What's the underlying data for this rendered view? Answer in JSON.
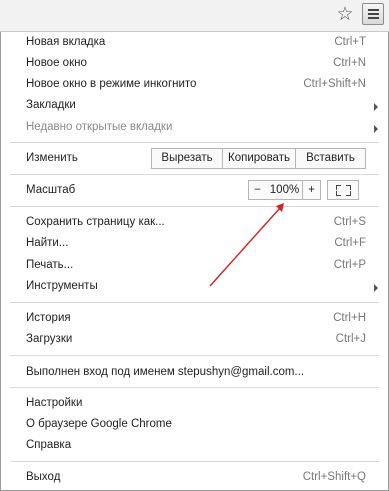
{
  "toolbar": {
    "star_glyph": "☆"
  },
  "menu": {
    "items": [
      {
        "label": "Новая вкладка",
        "shortcut": "Ctrl+T"
      },
      {
        "label": "Новое окно",
        "shortcut": "Ctrl+N"
      },
      {
        "label": "Новое окно в режиме инкогнито",
        "shortcut": "Ctrl+Shift+N"
      },
      {
        "label": "Закладки",
        "shortcut": ""
      },
      {
        "label": "Недавно открытые вкладки",
        "shortcut": ""
      }
    ],
    "edit": {
      "label": "Изменить",
      "cut": "Вырезать",
      "copy": "Копировать",
      "paste": "Вставить"
    },
    "zoom": {
      "label": "Масштаб",
      "minus": "−",
      "value": "100%",
      "plus": "+"
    },
    "page_items": [
      {
        "label": "Сохранить страницу как...",
        "shortcut": "Ctrl+S"
      },
      {
        "label": "Найти...",
        "shortcut": "Ctrl+F"
      },
      {
        "label": "Печать...",
        "shortcut": "Ctrl+P"
      },
      {
        "label": "Инструменты",
        "shortcut": ""
      }
    ],
    "history_items": [
      {
        "label": "История",
        "shortcut": "Ctrl+H"
      },
      {
        "label": "Загрузки",
        "shortcut": "Ctrl+J"
      }
    ],
    "signed_in": "Выполнен вход под именем stepushyn@gmail.com...",
    "settings_items": [
      {
        "label": "Настройки"
      },
      {
        "label": "О браузере Google Chrome"
      },
      {
        "label": "Справка"
      }
    ],
    "exit": {
      "label": "Выход",
      "shortcut": "Ctrl+Shift+Q"
    }
  },
  "colors": {
    "annotation_arrow": "#d42020"
  }
}
